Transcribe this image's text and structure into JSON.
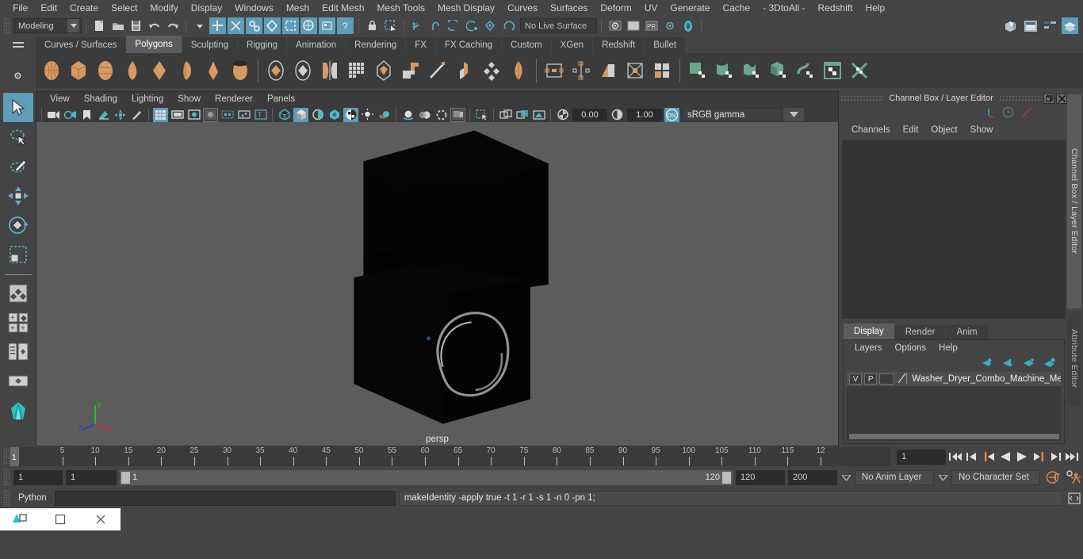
{
  "menubar": {
    "items": [
      "File",
      "Edit",
      "Create",
      "Select",
      "Modify",
      "Display",
      "Windows",
      "Mesh",
      "Edit Mesh",
      "Mesh Tools",
      "Mesh Display",
      "Curves",
      "Surfaces",
      "Deform",
      "UV",
      "Generate",
      "Cache",
      "- 3DtoAll -",
      "Redshift",
      "Help"
    ]
  },
  "statusline": {
    "mode": "Modeling",
    "live_surface": "No Live Surface"
  },
  "shelf": {
    "tabs": [
      "Curves / Surfaces",
      "Polygons",
      "Sculpting",
      "Rigging",
      "Animation",
      "Rendering",
      "FX",
      "FX Caching",
      "Custom",
      "XGen",
      "Redshift",
      "Bullet"
    ],
    "active_tab": "Polygons"
  },
  "viewport": {
    "menus": [
      "View",
      "Shading",
      "Lighting",
      "Show",
      "Renderer",
      "Panels"
    ],
    "exposure": "0.00",
    "gamma": "1.00",
    "color_profile": "sRGB gamma",
    "camera_label": "persp",
    "axis": {
      "x": "x",
      "y": "y",
      "z": "z"
    }
  },
  "channel_box": {
    "title": "Channel Box / Layer Editor",
    "menus": [
      "Channels",
      "Edit",
      "Object",
      "Show"
    ],
    "side_tabs": [
      "Channel Box / Layer Editor",
      "Attribute Editor"
    ]
  },
  "layer_editor": {
    "tabs": [
      "Display",
      "Render",
      "Anim"
    ],
    "active_tab": "Display",
    "menus": [
      "Layers",
      "Options",
      "Help"
    ],
    "layers": [
      {
        "visible": "V",
        "playback": "P",
        "name": "Washer_Dryer_Combo_Machine_Meta"
      }
    ]
  },
  "timeline": {
    "start": 1,
    "end": 120,
    "current_frame": "1",
    "tick_labels": [
      "5",
      "10",
      "15",
      "20",
      "25",
      "30",
      "35",
      "40",
      "45",
      "50",
      "55",
      "60",
      "65",
      "70",
      "75",
      "80",
      "85",
      "90",
      "95",
      "100",
      "105",
      "110",
      "115",
      "12"
    ],
    "playhead_label": "1"
  },
  "range": {
    "anim_start": "1",
    "range_start": "1",
    "range_slider_left": "1",
    "range_slider_right": "120",
    "range_end": "120",
    "anim_end": "200",
    "anim_layer": "No Anim Layer",
    "character_set": "No Character Set"
  },
  "command_line": {
    "language": "Python",
    "input_value": "",
    "output": "makeIdentity -apply true -t 1 -r 1 -s 1 -n 0 -pn 1;"
  },
  "taskbar": {
    "buttons": [
      "restore",
      "minimize",
      "close"
    ]
  },
  "colors": {
    "accent_blue": "#5e9cb8",
    "shelf_orange": "#d89a63",
    "shelf_green": "#6aa88d",
    "panel_bg": "#444444",
    "viewport_bg": "#5c5c5c"
  }
}
